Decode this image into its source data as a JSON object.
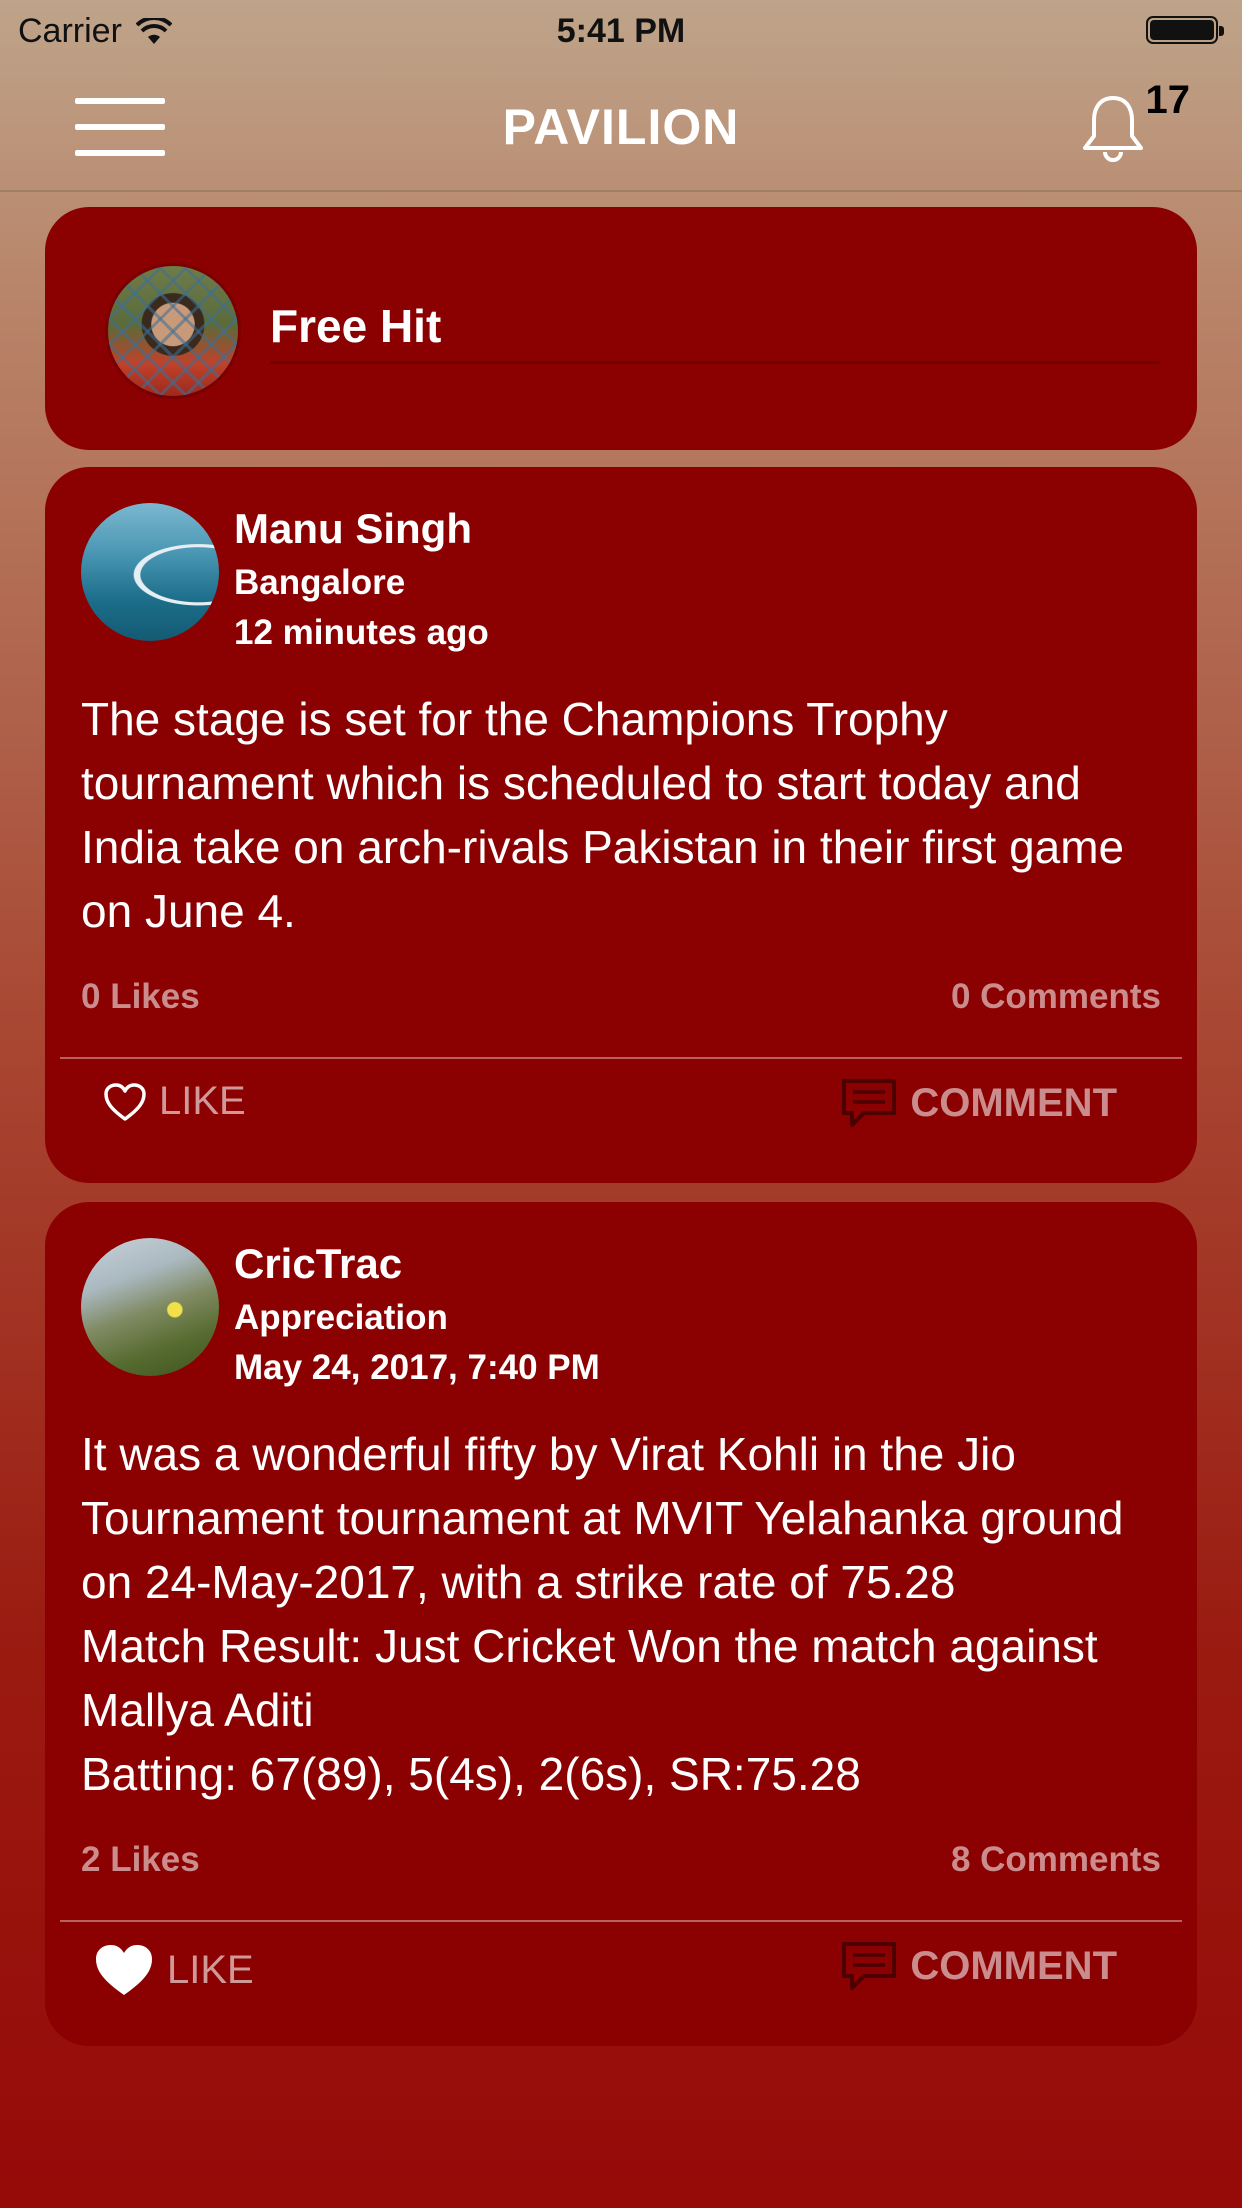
{
  "status_bar": {
    "carrier": "Carrier",
    "time": "5:41 PM"
  },
  "nav": {
    "title": "PAVILION",
    "notification_count": "17",
    "menu_icon": "hamburger-menu-icon",
    "bell_icon": "bell-icon"
  },
  "compose": {
    "placeholder": "Free Hit"
  },
  "posts": [
    {
      "author": "Manu Singh",
      "subtitle": "Bangalore",
      "time": "12 minutes ago",
      "body": "The stage is set for the Champions Trophy tournament which is scheduled to start today and India take on arch-rivals Pakistan in their first game on June 4.",
      "likes": "0 Likes",
      "comments": "0 Comments",
      "like_label": "LIKE",
      "comment_label": "COMMENT",
      "liked": false
    },
    {
      "author": "CricTrac",
      "subtitle": "Appreciation",
      "time": "May 24, 2017, 7:40 PM",
      "body": "It was a wonderful fifty by Virat Kohli in the Jio Tournament tournament at MVIT Yelahanka ground on 24-May-2017, with a strike rate of 75.28\nMatch Result: Just Cricket Won the match against Mallya Aditi\nBatting: 67(89), 5(4s), 2(6s), SR:75.28",
      "likes": "2 Likes",
      "comments": "8 Comments",
      "like_label": "LIKE",
      "comment_label": "COMMENT",
      "liked": true
    }
  ],
  "colors": {
    "card": "#8b0000",
    "header_top": "#bea48a",
    "accent_text": "#ffffff"
  }
}
